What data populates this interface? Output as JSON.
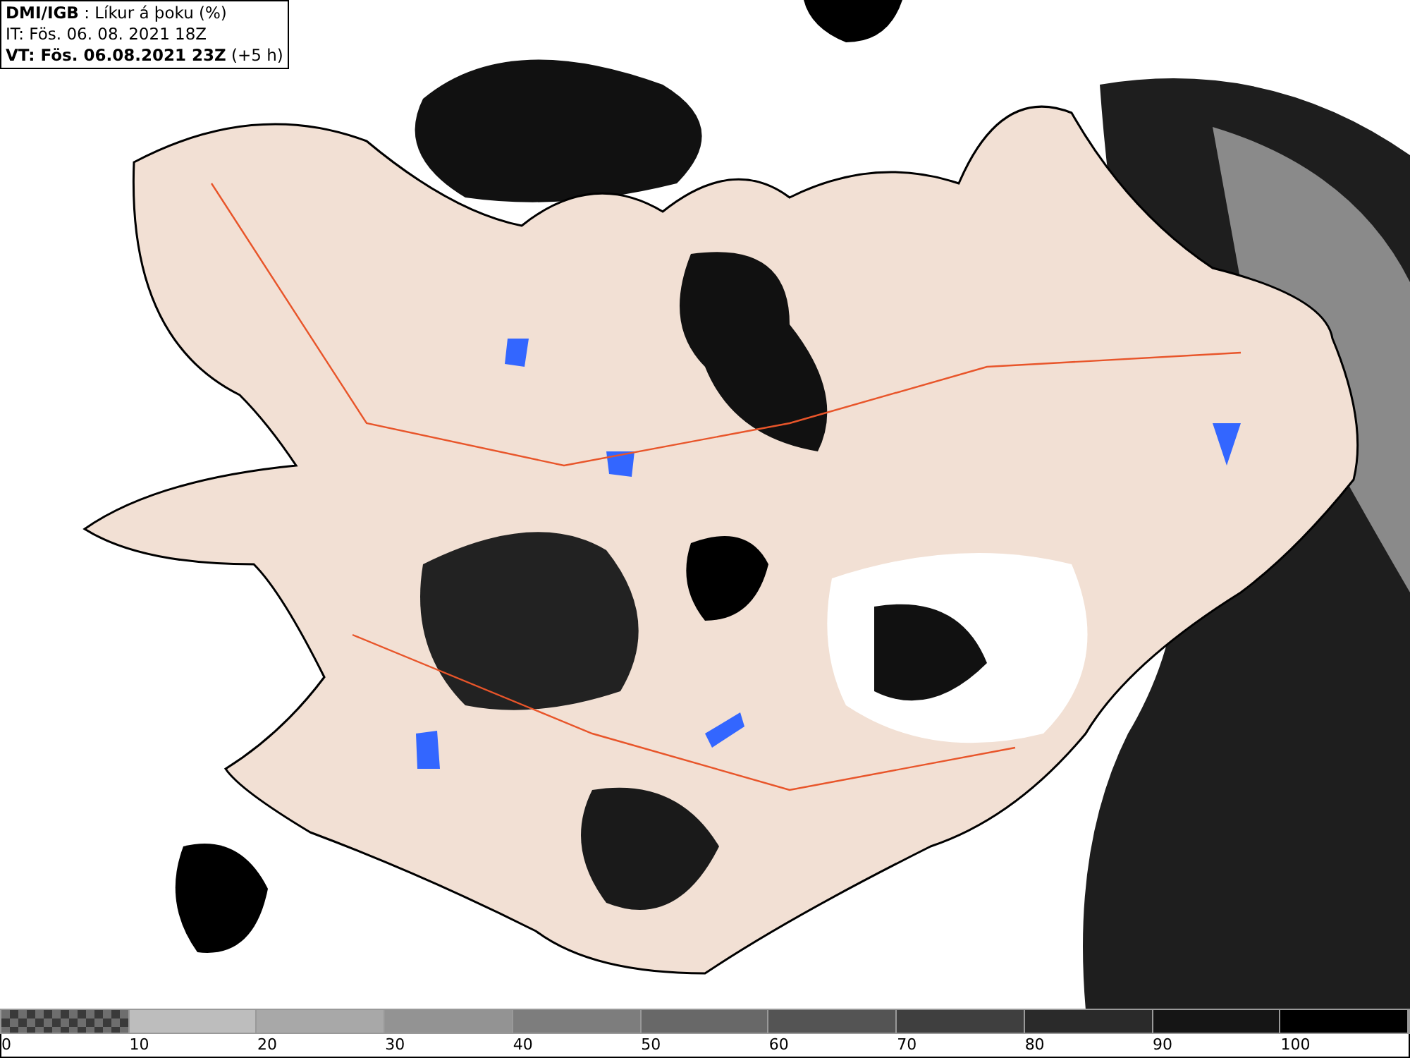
{
  "header": {
    "title": "**DMI/IGB** : Líkur á þoku (%)",
    "issued": "IT: Fös. 06. 08. 2021 18Z",
    "valid": "**VT: Fös. 06.08.2021 23Z** (+5 h)"
  },
  "legend": {
    "segments": [
      {
        "kind": "checker",
        "color": "#6e6e6e"
      },
      {
        "kind": "solid",
        "color": "#bdbdbd"
      },
      {
        "kind": "solid",
        "color": "#a8a8a8"
      },
      {
        "kind": "solid",
        "color": "#939393"
      },
      {
        "kind": "solid",
        "color": "#7d7d7d"
      },
      {
        "kind": "solid",
        "color": "#686868"
      },
      {
        "kind": "solid",
        "color": "#545454"
      },
      {
        "kind": "solid",
        "color": "#3f3f3f"
      },
      {
        "kind": "solid",
        "color": "#2a2a2a"
      },
      {
        "kind": "solid",
        "color": "#151515"
      },
      {
        "kind": "solid",
        "color": "#000000"
      }
    ],
    "labels": [
      "0",
      "10",
      "20",
      "30",
      "40",
      "50",
      "60",
      "70",
      "80",
      "90",
      "100"
    ]
  }
}
